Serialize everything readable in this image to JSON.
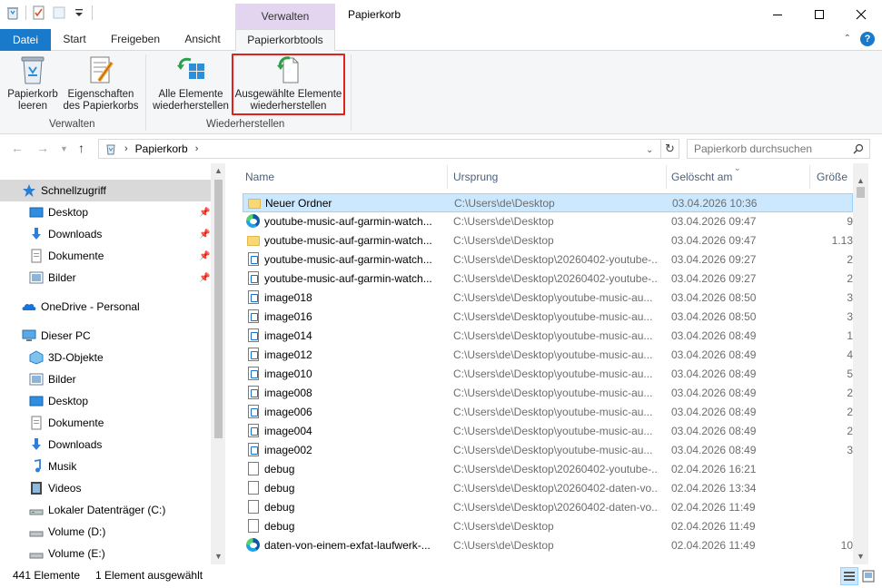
{
  "window": {
    "title": "Papierkorb",
    "context_tab_header": "Verwalten",
    "minimize": "—",
    "maximize": "☐",
    "close": "✕"
  },
  "ribbon_tabs": [
    {
      "label": "Datei"
    },
    {
      "label": "Start"
    },
    {
      "label": "Freigeben"
    },
    {
      "label": "Ansicht"
    },
    {
      "label": "Papierkorbtools"
    }
  ],
  "ribbon": {
    "groups": [
      {
        "label": "Verwalten",
        "buttons": [
          {
            "line1": "Papierkorb",
            "line2": "leeren",
            "icon": "recycle-bin-icon"
          },
          {
            "line1": "Eigenschaften",
            "line2": "des Papierkorbs",
            "icon": "properties-icon"
          }
        ]
      },
      {
        "label": "Wiederherstellen",
        "buttons": [
          {
            "line1": "Alle Elemente",
            "line2": "wiederherstellen",
            "icon": "restore-all-icon"
          },
          {
            "line1": "Ausgewählte Elemente",
            "line2": "wiederherstellen",
            "icon": "restore-selected-icon"
          }
        ]
      }
    ]
  },
  "address": {
    "path": "Papierkorb",
    "search_placeholder": "Papierkorb durchsuchen"
  },
  "sidebar": {
    "items": [
      {
        "label": "Schnellzugriff",
        "icon": "star-icon"
      },
      {
        "label": "Desktop",
        "icon": "desktop-icon"
      },
      {
        "label": "Downloads",
        "icon": "download-icon"
      },
      {
        "label": "Dokumente",
        "icon": "documents-icon"
      },
      {
        "label": "Bilder",
        "icon": "pictures-icon"
      },
      {
        "label": "OneDrive - Personal",
        "icon": "onedrive-icon"
      },
      {
        "label": "Dieser PC",
        "icon": "pc-icon"
      },
      {
        "label": "3D-Objekte",
        "icon": "3d-objects-icon"
      },
      {
        "label": "Bilder",
        "icon": "pictures-icon"
      },
      {
        "label": "Desktop",
        "icon": "desktop-icon"
      },
      {
        "label": "Dokumente",
        "icon": "documents-icon"
      },
      {
        "label": "Downloads",
        "icon": "download-icon"
      },
      {
        "label": "Musik",
        "icon": "music-icon"
      },
      {
        "label": "Videos",
        "icon": "videos-icon"
      },
      {
        "label": "Lokaler Datenträger (C:)",
        "icon": "drive-icon"
      },
      {
        "label": "Volume (D:)",
        "icon": "drive-icon"
      },
      {
        "label": "Volume (E:)",
        "icon": "drive-icon"
      }
    ]
  },
  "columns": {
    "name": "Name",
    "origin": "Ursprung",
    "deleted": "Gelöscht am",
    "size": "Größe"
  },
  "files": [
    {
      "name": "Neuer Ordner",
      "origin": "C:\\Users\\de\\Desktop",
      "deleted": "03.04.2026 10:36",
      "size": "",
      "icon": "folder-icon"
    },
    {
      "name": "youtube-music-auf-garmin-watch...",
      "origin": "C:\\Users\\de\\Desktop",
      "deleted": "03.04.2026 09:47",
      "size": "9",
      "icon": "edge-icon"
    },
    {
      "name": "youtube-music-auf-garmin-watch...",
      "origin": "C:\\Users\\de\\Desktop",
      "deleted": "03.04.2026 09:47",
      "size": "1.13",
      "icon": "folder-icon"
    },
    {
      "name": "youtube-music-auf-garmin-watch...",
      "origin": "C:\\Users\\de\\Desktop\\20260402-youtube-...",
      "deleted": "03.04.2026 09:27",
      "size": "2",
      "icon": "image-icon"
    },
    {
      "name": "youtube-music-auf-garmin-watch...",
      "origin": "C:\\Users\\de\\Desktop\\20260402-youtube-...",
      "deleted": "03.04.2026 09:27",
      "size": "2",
      "icon": "image-icon"
    },
    {
      "name": "image018",
      "origin": "C:\\Users\\de\\Desktop\\youtube-music-au...",
      "deleted": "03.04.2026 08:50",
      "size": "3",
      "icon": "image-icon"
    },
    {
      "name": "image016",
      "origin": "C:\\Users\\de\\Desktop\\youtube-music-au...",
      "deleted": "03.04.2026 08:50",
      "size": "3",
      "icon": "image-icon"
    },
    {
      "name": "image014",
      "origin": "C:\\Users\\de\\Desktop\\youtube-music-au...",
      "deleted": "03.04.2026 08:49",
      "size": "1",
      "icon": "image-icon"
    },
    {
      "name": "image012",
      "origin": "C:\\Users\\de\\Desktop\\youtube-music-au...",
      "deleted": "03.04.2026 08:49",
      "size": "4",
      "icon": "image-icon"
    },
    {
      "name": "image010",
      "origin": "C:\\Users\\de\\Desktop\\youtube-music-au...",
      "deleted": "03.04.2026 08:49",
      "size": "5",
      "icon": "image-icon"
    },
    {
      "name": "image008",
      "origin": "C:\\Users\\de\\Desktop\\youtube-music-au...",
      "deleted": "03.04.2026 08:49",
      "size": "2",
      "icon": "image-icon"
    },
    {
      "name": "image006",
      "origin": "C:\\Users\\de\\Desktop\\youtube-music-au...",
      "deleted": "03.04.2026 08:49",
      "size": "2",
      "icon": "image-icon"
    },
    {
      "name": "image004",
      "origin": "C:\\Users\\de\\Desktop\\youtube-music-au...",
      "deleted": "03.04.2026 08:49",
      "size": "2",
      "icon": "image-icon"
    },
    {
      "name": "image002",
      "origin": "C:\\Users\\de\\Desktop\\youtube-music-au...",
      "deleted": "03.04.2026 08:49",
      "size": "3",
      "icon": "image-icon"
    },
    {
      "name": "debug",
      "origin": "C:\\Users\\de\\Desktop\\20260402-youtube-...",
      "deleted": "02.04.2026 16:21",
      "size": "",
      "icon": "text-file-icon"
    },
    {
      "name": "debug",
      "origin": "C:\\Users\\de\\Desktop\\20260402-daten-vo...",
      "deleted": "02.04.2026 13:34",
      "size": "",
      "icon": "text-file-icon"
    },
    {
      "name": "debug",
      "origin": "C:\\Users\\de\\Desktop\\20260402-daten-vo...",
      "deleted": "02.04.2026 11:49",
      "size": "",
      "icon": "text-file-icon"
    },
    {
      "name": "debug",
      "origin": "C:\\Users\\de\\Desktop",
      "deleted": "02.04.2026 11:49",
      "size": "",
      "icon": "text-file-icon"
    },
    {
      "name": "daten-von-einem-exfat-laufwerk-...",
      "origin": "C:\\Users\\de\\Desktop",
      "deleted": "02.04.2026 11:49",
      "size": "10",
      "icon": "edge-icon"
    }
  ],
  "status": {
    "count": "441 Elemente",
    "selected": "1 Element ausgewählt"
  }
}
